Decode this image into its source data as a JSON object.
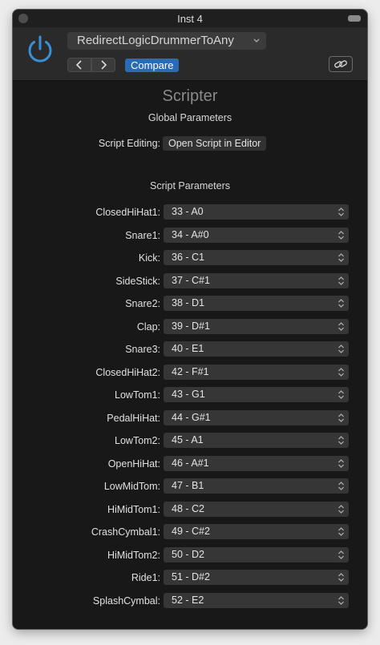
{
  "window": {
    "title": "Inst 4"
  },
  "header": {
    "preset_name": "RedirectLogicDrummerToAny",
    "compare_label": "Compare"
  },
  "content": {
    "plugin_name": "Scripter",
    "global_params_title": "Global Parameters",
    "script_editing_label": "Script Editing:",
    "open_editor_label": "Open Script in Editor",
    "script_params_title": "Script Parameters",
    "params": [
      {
        "label": "ClosedHiHat1:",
        "value": "33 - A0"
      },
      {
        "label": "Snare1:",
        "value": "34 - A#0"
      },
      {
        "label": "Kick:",
        "value": "36 - C1"
      },
      {
        "label": "SideStick:",
        "value": "37 - C#1"
      },
      {
        "label": "Snare2:",
        "value": "38 - D1"
      },
      {
        "label": "Clap:",
        "value": "39 - D#1"
      },
      {
        "label": "Snare3:",
        "value": "40 - E1"
      },
      {
        "label": "ClosedHiHat2:",
        "value": "42 - F#1"
      },
      {
        "label": "LowTom1:",
        "value": "43 - G1"
      },
      {
        "label": "PedalHiHat:",
        "value": "44 - G#1"
      },
      {
        "label": "LowTom2:",
        "value": "45 - A1"
      },
      {
        "label": "OpenHiHat:",
        "value": "46 - A#1"
      },
      {
        "label": "LowMidTom:",
        "value": "47 - B1"
      },
      {
        "label": "HiMidTom1:",
        "value": "48 - C2"
      },
      {
        "label": "CrashCymbal1:",
        "value": "49 - C#2"
      },
      {
        "label": "HiMidTom2:",
        "value": "50 - D2"
      },
      {
        "label": "Ride1:",
        "value": "51 - D#2"
      },
      {
        "label": "SplashCymbal:",
        "value": "52 - E2"
      }
    ]
  },
  "colors": {
    "power_icon": "#3a8fd9",
    "compare_button": "#2b6bb3",
    "background": "#181818"
  },
  "icons": {
    "power": "power-icon",
    "previous": "chevron-left-icon",
    "next": "chevron-right-icon",
    "link": "link-icon",
    "dropdown": "chevron-down-icon",
    "stepper": "up-down-chevron-icon"
  }
}
